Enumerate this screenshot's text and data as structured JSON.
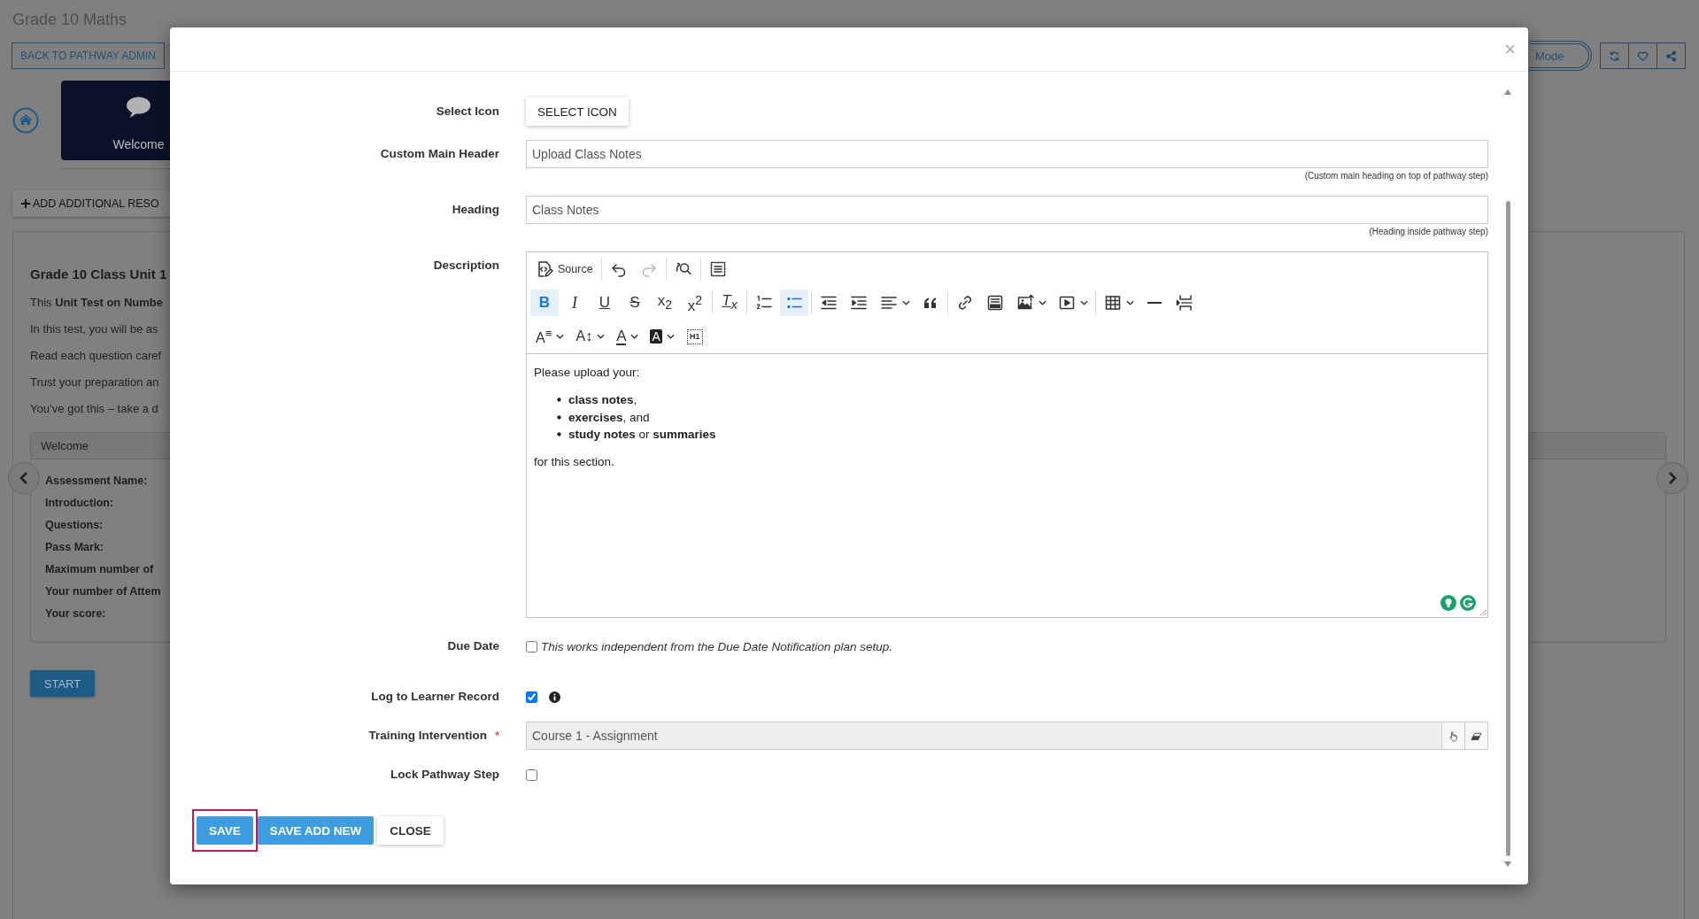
{
  "page": {
    "title": "Grade 10 Maths",
    "back_button": "BACK TO PATHWAY ADMIN",
    "mode_toggle": "Mode",
    "step_card": {
      "title": "Welcome"
    },
    "add_button": "ADD ADDITIONAL RESO",
    "content": {
      "title": "Grade 10 Class Unit 1",
      "paragraphs": [
        "This **Unit Test on Numbe**",
        "In this test, you will be as",
        "Read each question caref",
        "Trust your preparation an",
        "You’ve got this – take a d"
      ],
      "details": {
        "header": "Welcome",
        "labels": [
          "Assessment Name:",
          "Introduction:",
          "Questions:",
          "Pass Mark:",
          "Maximum number of",
          "Your number of Attem",
          "Your score:"
        ]
      },
      "start_button": "START"
    }
  },
  "modal": {
    "close": "×",
    "fields": [
      {
        "kind": "button",
        "label": "Select Icon",
        "button": "SELECT ICON"
      },
      {
        "kind": "text",
        "label": "Custom Main Header",
        "value": "Upload Class Notes",
        "help": "(Custom main heading on top of pathway step)"
      },
      {
        "kind": "text",
        "label": "Heading",
        "value": "Class Notes",
        "help": "(Heading inside pathway step)"
      },
      {
        "kind": "editor",
        "label": "Description",
        "toolbar": [
          [
            [
              {
                "kind": "source",
                "label": "Source",
                "on": false,
                "disabled": false
              }
            ],
            [
              {
                "kind": "undo",
                "on": false,
                "disabled": false
              },
              {
                "kind": "redo",
                "on": false,
                "disabled": true
              }
            ],
            [
              {
                "kind": "find-replace",
                "on": false,
                "disabled": false
              }
            ],
            [
              {
                "kind": "select-all",
                "on": false,
                "disabled": false
              }
            ]
          ],
          [
            [
              {
                "kind": "bold",
                "glyph": "B",
                "on": true,
                "disabled": false
              },
              {
                "kind": "italic",
                "glyph": "I",
                "on": false,
                "disabled": false
              },
              {
                "kind": "underline",
                "glyph": "U",
                "on": false,
                "disabled": false
              },
              {
                "kind": "strikethrough",
                "glyph": "S",
                "on": false,
                "disabled": false
              },
              {
                "kind": "subscript",
                "glyph": "x$_{2}$",
                "on": false,
                "disabled": false
              },
              {
                "kind": "superscript",
                "glyph": "x$^{2}$",
                "on": false,
                "disabled": false
              }
            ],
            [
              {
                "kind": "remove-format",
                "glyph": "T$_{x}$",
                "on": false,
                "disabled": false
              }
            ],
            [
              {
                "kind": "numbered-list",
                "on": false,
                "disabled": false
              },
              {
                "kind": "bulleted-list",
                "on": true,
                "disabled": false
              }
            ],
            [
              {
                "kind": "outdent",
                "on": false,
                "disabled": false
              },
              {
                "kind": "indent",
                "on": false,
                "disabled": false
              },
              {
                "kind": "align",
                "dropdown": true,
                "on": false,
                "disabled": false
              },
              {
                "kind": "block-quote",
                "on": false,
                "disabled": false
              }
            ],
            [
              {
                "kind": "link",
                "on": false,
                "disabled": false
              },
              {
                "kind": "html-embed",
                "on": false,
                "disabled": false
              },
              {
                "kind": "image",
                "dropdown": true,
                "on": false,
                "disabled": false
              },
              {
                "kind": "media",
                "dropdown": true,
                "on": false,
                "disabled": false
              }
            ],
            [
              {
                "kind": "table",
                "dropdown": true,
                "on": false,
                "disabled": false
              },
              {
                "kind": "horizontal-line",
                "on": false,
                "disabled": false
              },
              {
                "kind": "page-break",
                "on": false,
                "disabled": false
              }
            ]
          ],
          [
            [
              {
                "kind": "heading",
                "glyph": "A$^{≡}$",
                "dropdown": true,
                "on": false,
                "disabled": false
              },
              {
                "kind": "font-size",
                "glyph": "A↕",
                "dropdown": true,
                "on": false,
                "disabled": false
              },
              {
                "kind": "font-color",
                "glyph": "A",
                "dropdown": true,
                "on": false,
                "disabled": false
              },
              {
                "kind": "font-background",
                "glyph": "A",
                "dropdown": true,
                "on": false,
                "disabled": false
              },
              {
                "kind": "show-blocks",
                "glyph": "H1",
                "on": false,
                "disabled": false
              }
            ]
          ]
        ],
        "content": [
          {
            "kind": "paragraph",
            "text": "Please upload your:"
          },
          {
            "kind": "list",
            "items": [
              "**class notes**,",
              "**exercises**, and",
              "**study notes** or **summaries**"
            ]
          },
          {
            "kind": "paragraph",
            "text": "for this section."
          }
        ]
      },
      {
        "kind": "checkbox",
        "label": "Due Date",
        "checked": false,
        "note": "This works independent from the Due Date Notification plan setup."
      },
      {
        "kind": "checkbox",
        "label": "Log to Learner Record",
        "checked": true,
        "info": true
      },
      {
        "kind": "lookup",
        "label": "Training Intervention",
        "required_mark": "*",
        "value": "Course 1 - Assignment"
      },
      {
        "kind": "checkbox",
        "label": "Lock Pathway Step",
        "checked": false
      }
    ],
    "buttons": [
      {
        "label": "SAVE",
        "kind": "primary",
        "highlighted": true
      },
      {
        "label": "SAVE ADD NEW",
        "kind": "primary",
        "highlighted": false
      },
      {
        "label": "CLOSE",
        "kind": "default",
        "highlighted": false
      }
    ]
  }
}
